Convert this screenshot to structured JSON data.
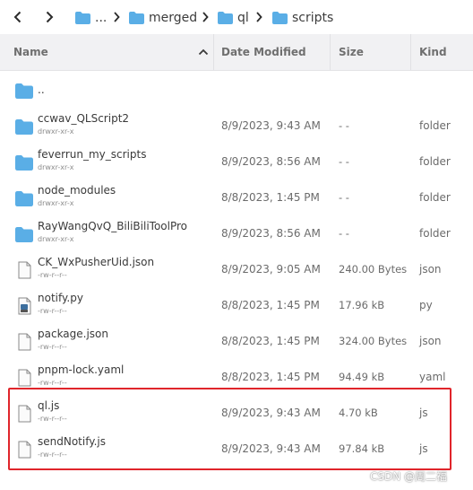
{
  "breadcrumb": {
    "items": [
      {
        "label": "...",
        "icon": "folder-icon"
      },
      {
        "label": "merged",
        "icon": "folder-icon"
      },
      {
        "label": "ql",
        "icon": "folder-icon"
      },
      {
        "label": "scripts",
        "icon": "folder-icon"
      }
    ]
  },
  "columns": {
    "name": "Name",
    "date": "Date Modified",
    "size": "Size",
    "kind": "Kind"
  },
  "files": [
    {
      "name": "..",
      "perm": "",
      "date": "",
      "size": "",
      "kind": "",
      "icon": "folder-icon"
    },
    {
      "name": "ccwav_QLScript2",
      "perm": "drwxr-xr-x",
      "date": "8/9/2023, 9:43 AM",
      "size": "- -",
      "kind": "folder",
      "icon": "folder-icon"
    },
    {
      "name": "feverrun_my_scripts",
      "perm": "drwxr-xr-x",
      "date": "8/9/2023, 8:56 AM",
      "size": "- -",
      "kind": "folder",
      "icon": "folder-icon"
    },
    {
      "name": "node_modules",
      "perm": "drwxr-xr-x",
      "date": "8/8/2023, 1:45 PM",
      "size": "- -",
      "kind": "folder",
      "icon": "folder-icon"
    },
    {
      "name": "RayWangQvQ_BiliBiliToolPro",
      "perm": "drwxr-xr-x",
      "date": "8/9/2023, 8:56 AM",
      "size": "- -",
      "kind": "folder",
      "icon": "folder-icon"
    },
    {
      "name": "CK_WxPusherUid.json",
      "perm": "-rw-r--r--",
      "date": "8/9/2023, 9:05 AM",
      "size": "240.00 Bytes",
      "kind": "json",
      "icon": "file-icon"
    },
    {
      "name": "notify.py",
      "perm": "-rw-r--r--",
      "date": "8/8/2023, 1:45 PM",
      "size": "17.96 kB",
      "kind": "py",
      "icon": "python-file-icon"
    },
    {
      "name": "package.json",
      "perm": "-rw-r--r--",
      "date": "8/8/2023, 1:45 PM",
      "size": "324.00 Bytes",
      "kind": "json",
      "icon": "file-icon"
    },
    {
      "name": "pnpm-lock.yaml",
      "perm": "-rw-r--r--",
      "date": "8/8/2023, 1:45 PM",
      "size": "94.49 kB",
      "kind": "yaml",
      "icon": "file-icon"
    },
    {
      "name": "ql.js",
      "perm": "-rw-r--r--",
      "date": "8/9/2023, 9:43 AM",
      "size": "4.70 kB",
      "kind": "js",
      "icon": "file-icon"
    },
    {
      "name": "sendNotify.js",
      "perm": "-rw-r--r--",
      "date": "8/9/2023, 9:43 AM",
      "size": "97.84 kB",
      "kind": "js",
      "icon": "file-icon"
    }
  ],
  "watermark": "CSDN @周二福",
  "colors": {
    "folder": "#5aaee6",
    "header_bg": "#f1f1f3",
    "highlight": "#e0252b"
  }
}
